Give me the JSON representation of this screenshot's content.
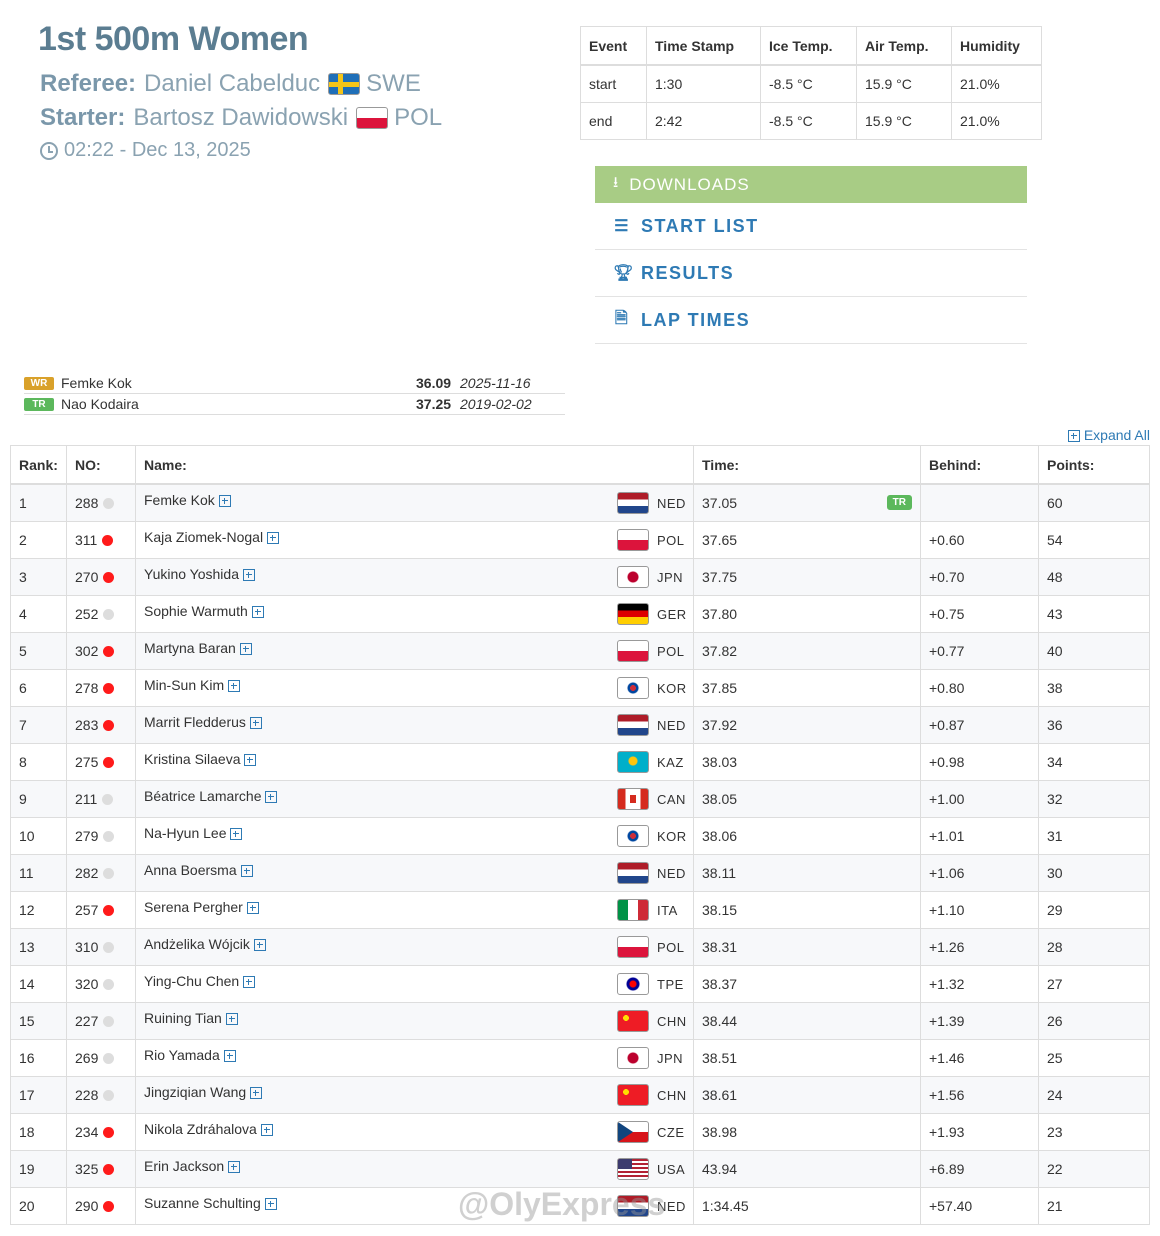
{
  "header": {
    "title": "1st 500m Women",
    "referee_label": "Referee:",
    "referee_name": "Daniel Cabelduc",
    "referee_country": "SWE",
    "starter_label": "Starter:",
    "starter_name": "Bartosz Dawidowski",
    "starter_country": "POL",
    "datetime": "02:22 - Dec 13, 2025"
  },
  "conditions": {
    "headers": [
      "Event",
      "Time Stamp",
      "Ice Temp.",
      "Air Temp.",
      "Humidity"
    ],
    "rows": [
      [
        "start",
        "1:30",
        "-8.5 °C",
        "15.9 °C",
        "21.0%"
      ],
      [
        "end",
        "2:42",
        "-8.5 °C",
        "15.9 °C",
        "21.0%"
      ]
    ]
  },
  "downloads": {
    "header": "DOWNLOADS",
    "items": [
      "START LIST",
      "RESULTS",
      "LAP TIMES"
    ]
  },
  "records": [
    {
      "badge": "WR",
      "color": "#d9a12a",
      "name": "Femke Kok",
      "time": "36.09",
      "date": "2025-11-16"
    },
    {
      "badge": "TR",
      "color": "#5cb85c",
      "name": "Nao Kodaira",
      "time": "37.25",
      "date": "2019-02-02"
    }
  ],
  "expand_all": "Expand All",
  "results": {
    "headers": {
      "rank": "Rank:",
      "no": "NO:",
      "name": "Name:",
      "time": "Time:",
      "behind": "Behind:",
      "points": "Points:"
    },
    "rows": [
      {
        "rank": "1",
        "no": "288",
        "dot": "grey",
        "name": "Femke Kok",
        "nat": "NED",
        "time": "37.05",
        "badge": "TR",
        "behind": "",
        "points": "60"
      },
      {
        "rank": "2",
        "no": "311",
        "dot": "red",
        "name": "Kaja Ziomek-Nogal",
        "nat": "POL",
        "time": "37.65",
        "behind": "+0.60",
        "points": "54"
      },
      {
        "rank": "3",
        "no": "270",
        "dot": "red",
        "name": "Yukino Yoshida",
        "nat": "JPN",
        "time": "37.75",
        "behind": "+0.70",
        "points": "48"
      },
      {
        "rank": "4",
        "no": "252",
        "dot": "grey",
        "name": "Sophie Warmuth",
        "nat": "GER",
        "time": "37.80",
        "behind": "+0.75",
        "points": "43"
      },
      {
        "rank": "5",
        "no": "302",
        "dot": "red",
        "name": "Martyna Baran",
        "nat": "POL",
        "time": "37.82",
        "behind": "+0.77",
        "points": "40"
      },
      {
        "rank": "6",
        "no": "278",
        "dot": "red",
        "name": "Min-Sun Kim",
        "nat": "KOR",
        "time": "37.85",
        "behind": "+0.80",
        "points": "38"
      },
      {
        "rank": "7",
        "no": "283",
        "dot": "red",
        "name": "Marrit Fledderus",
        "nat": "NED",
        "time": "37.92",
        "behind": "+0.87",
        "points": "36"
      },
      {
        "rank": "8",
        "no": "275",
        "dot": "red",
        "name": "Kristina Silaeva",
        "nat": "KAZ",
        "time": "38.03",
        "behind": "+0.98",
        "points": "34"
      },
      {
        "rank": "9",
        "no": "211",
        "dot": "grey",
        "name": "Béatrice Lamarche",
        "nat": "CAN",
        "time": "38.05",
        "behind": "+1.00",
        "points": "32"
      },
      {
        "rank": "10",
        "no": "279",
        "dot": "grey",
        "name": "Na-Hyun Lee",
        "nat": "KOR",
        "time": "38.06",
        "behind": "+1.01",
        "points": "31"
      },
      {
        "rank": "11",
        "no": "282",
        "dot": "grey",
        "name": "Anna Boersma",
        "nat": "NED",
        "time": "38.11",
        "behind": "+1.06",
        "points": "30"
      },
      {
        "rank": "12",
        "no": "257",
        "dot": "red",
        "name": "Serena Pergher",
        "nat": "ITA",
        "time": "38.15",
        "behind": "+1.10",
        "points": "29"
      },
      {
        "rank": "13",
        "no": "310",
        "dot": "grey",
        "name": "Andżelika Wójcik",
        "nat": "POL",
        "time": "38.31",
        "behind": "+1.26",
        "points": "28"
      },
      {
        "rank": "14",
        "no": "320",
        "dot": "grey",
        "name": "Ying-Chu Chen",
        "nat": "TPE",
        "time": "38.37",
        "behind": "+1.32",
        "points": "27"
      },
      {
        "rank": "15",
        "no": "227",
        "dot": "grey",
        "name": "Ruining Tian",
        "nat": "CHN",
        "time": "38.44",
        "behind": "+1.39",
        "points": "26"
      },
      {
        "rank": "16",
        "no": "269",
        "dot": "grey",
        "name": "Rio Yamada",
        "nat": "JPN",
        "time": "38.51",
        "behind": "+1.46",
        "points": "25"
      },
      {
        "rank": "17",
        "no": "228",
        "dot": "grey",
        "name": "Jingziqian Wang",
        "nat": "CHN",
        "time": "38.61",
        "behind": "+1.56",
        "points": "24"
      },
      {
        "rank": "18",
        "no": "234",
        "dot": "red",
        "name": "Nikola Zdráhalova",
        "nat": "CZE",
        "time": "38.98",
        "behind": "+1.93",
        "points": "23"
      },
      {
        "rank": "19",
        "no": "325",
        "dot": "red",
        "name": "Erin Jackson",
        "nat": "USA",
        "time": "43.94",
        "behind": "+6.89",
        "points": "22"
      },
      {
        "rank": "20",
        "no": "290",
        "dot": "red",
        "name": "Suzanne Schulting",
        "nat": "NED",
        "time": "1:34.45",
        "behind": "+57.40",
        "points": "21"
      }
    ]
  },
  "watermark": "@OlyExpress",
  "colors": {
    "accent": "#2e7ab4",
    "title": "#5b7d91",
    "downloads_bg": "#a8cc85",
    "red_dot": "#ff1a1a",
    "grey_dot": "#dddddd"
  }
}
